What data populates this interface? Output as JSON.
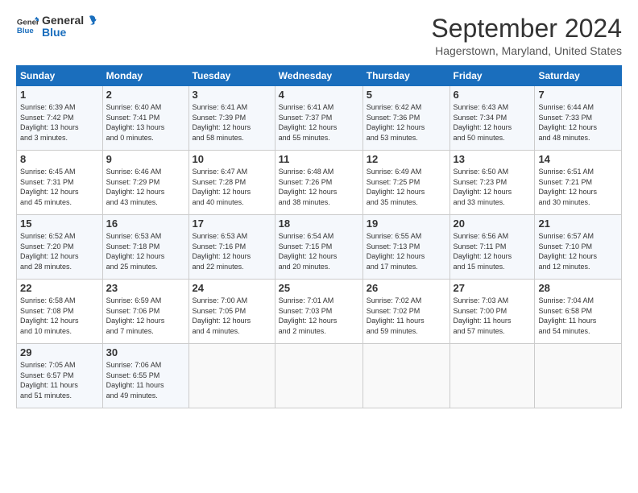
{
  "logo": {
    "line1": "General",
    "line2": "Blue"
  },
  "title": "September 2024",
  "location": "Hagerstown, Maryland, United States",
  "headers": [
    "Sunday",
    "Monday",
    "Tuesday",
    "Wednesday",
    "Thursday",
    "Friday",
    "Saturday"
  ],
  "weeks": [
    [
      {
        "day": "1",
        "lines": [
          "Sunrise: 6:39 AM",
          "Sunset: 7:42 PM",
          "Daylight: 13 hours",
          "and 3 minutes."
        ]
      },
      {
        "day": "2",
        "lines": [
          "Sunrise: 6:40 AM",
          "Sunset: 7:41 PM",
          "Daylight: 13 hours",
          "and 0 minutes."
        ]
      },
      {
        "day": "3",
        "lines": [
          "Sunrise: 6:41 AM",
          "Sunset: 7:39 PM",
          "Daylight: 12 hours",
          "and 58 minutes."
        ]
      },
      {
        "day": "4",
        "lines": [
          "Sunrise: 6:41 AM",
          "Sunset: 7:37 PM",
          "Daylight: 12 hours",
          "and 55 minutes."
        ]
      },
      {
        "day": "5",
        "lines": [
          "Sunrise: 6:42 AM",
          "Sunset: 7:36 PM",
          "Daylight: 12 hours",
          "and 53 minutes."
        ]
      },
      {
        "day": "6",
        "lines": [
          "Sunrise: 6:43 AM",
          "Sunset: 7:34 PM",
          "Daylight: 12 hours",
          "and 50 minutes."
        ]
      },
      {
        "day": "7",
        "lines": [
          "Sunrise: 6:44 AM",
          "Sunset: 7:33 PM",
          "Daylight: 12 hours",
          "and 48 minutes."
        ]
      }
    ],
    [
      {
        "day": "8",
        "lines": [
          "Sunrise: 6:45 AM",
          "Sunset: 7:31 PM",
          "Daylight: 12 hours",
          "and 45 minutes."
        ]
      },
      {
        "day": "9",
        "lines": [
          "Sunrise: 6:46 AM",
          "Sunset: 7:29 PM",
          "Daylight: 12 hours",
          "and 43 minutes."
        ]
      },
      {
        "day": "10",
        "lines": [
          "Sunrise: 6:47 AM",
          "Sunset: 7:28 PM",
          "Daylight: 12 hours",
          "and 40 minutes."
        ]
      },
      {
        "day": "11",
        "lines": [
          "Sunrise: 6:48 AM",
          "Sunset: 7:26 PM",
          "Daylight: 12 hours",
          "and 38 minutes."
        ]
      },
      {
        "day": "12",
        "lines": [
          "Sunrise: 6:49 AM",
          "Sunset: 7:25 PM",
          "Daylight: 12 hours",
          "and 35 minutes."
        ]
      },
      {
        "day": "13",
        "lines": [
          "Sunrise: 6:50 AM",
          "Sunset: 7:23 PM",
          "Daylight: 12 hours",
          "and 33 minutes."
        ]
      },
      {
        "day": "14",
        "lines": [
          "Sunrise: 6:51 AM",
          "Sunset: 7:21 PM",
          "Daylight: 12 hours",
          "and 30 minutes."
        ]
      }
    ],
    [
      {
        "day": "15",
        "lines": [
          "Sunrise: 6:52 AM",
          "Sunset: 7:20 PM",
          "Daylight: 12 hours",
          "and 28 minutes."
        ]
      },
      {
        "day": "16",
        "lines": [
          "Sunrise: 6:53 AM",
          "Sunset: 7:18 PM",
          "Daylight: 12 hours",
          "and 25 minutes."
        ]
      },
      {
        "day": "17",
        "lines": [
          "Sunrise: 6:53 AM",
          "Sunset: 7:16 PM",
          "Daylight: 12 hours",
          "and 22 minutes."
        ]
      },
      {
        "day": "18",
        "lines": [
          "Sunrise: 6:54 AM",
          "Sunset: 7:15 PM",
          "Daylight: 12 hours",
          "and 20 minutes."
        ]
      },
      {
        "day": "19",
        "lines": [
          "Sunrise: 6:55 AM",
          "Sunset: 7:13 PM",
          "Daylight: 12 hours",
          "and 17 minutes."
        ]
      },
      {
        "day": "20",
        "lines": [
          "Sunrise: 6:56 AM",
          "Sunset: 7:11 PM",
          "Daylight: 12 hours",
          "and 15 minutes."
        ]
      },
      {
        "day": "21",
        "lines": [
          "Sunrise: 6:57 AM",
          "Sunset: 7:10 PM",
          "Daylight: 12 hours",
          "and 12 minutes."
        ]
      }
    ],
    [
      {
        "day": "22",
        "lines": [
          "Sunrise: 6:58 AM",
          "Sunset: 7:08 PM",
          "Daylight: 12 hours",
          "and 10 minutes."
        ]
      },
      {
        "day": "23",
        "lines": [
          "Sunrise: 6:59 AM",
          "Sunset: 7:06 PM",
          "Daylight: 12 hours",
          "and 7 minutes."
        ]
      },
      {
        "day": "24",
        "lines": [
          "Sunrise: 7:00 AM",
          "Sunset: 7:05 PM",
          "Daylight: 12 hours",
          "and 4 minutes."
        ]
      },
      {
        "day": "25",
        "lines": [
          "Sunrise: 7:01 AM",
          "Sunset: 7:03 PM",
          "Daylight: 12 hours",
          "and 2 minutes."
        ]
      },
      {
        "day": "26",
        "lines": [
          "Sunrise: 7:02 AM",
          "Sunset: 7:02 PM",
          "Daylight: 11 hours",
          "and 59 minutes."
        ]
      },
      {
        "day": "27",
        "lines": [
          "Sunrise: 7:03 AM",
          "Sunset: 7:00 PM",
          "Daylight: 11 hours",
          "and 57 minutes."
        ]
      },
      {
        "day": "28",
        "lines": [
          "Sunrise: 7:04 AM",
          "Sunset: 6:58 PM",
          "Daylight: 11 hours",
          "and 54 minutes."
        ]
      }
    ],
    [
      {
        "day": "29",
        "lines": [
          "Sunrise: 7:05 AM",
          "Sunset: 6:57 PM",
          "Daylight: 11 hours",
          "and 51 minutes."
        ]
      },
      {
        "day": "30",
        "lines": [
          "Sunrise: 7:06 AM",
          "Sunset: 6:55 PM",
          "Daylight: 11 hours",
          "and 49 minutes."
        ]
      },
      null,
      null,
      null,
      null,
      null
    ]
  ]
}
